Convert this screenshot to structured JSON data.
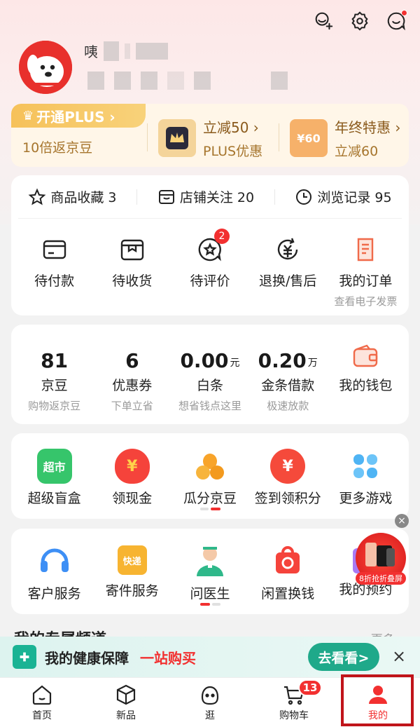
{
  "header": {
    "user_name_prefix": "咦",
    "icons": [
      "add-friend-icon",
      "settings-icon",
      "message-icon"
    ]
  },
  "plus": {
    "badge_label": "开通PLUS ›",
    "badge_sub": "10倍返京豆",
    "item1_title": "立减50 ›",
    "item1_sub": "PLUS优惠",
    "item2_title": "年终特惠 ›",
    "item2_sub": "立减60",
    "item2_icon_text": "¥60"
  },
  "favorites": {
    "items": [
      {
        "label": "商品收藏 3"
      },
      {
        "label": "店铺关注 20"
      },
      {
        "label": "浏览记录 95"
      }
    ]
  },
  "orders": {
    "items": [
      {
        "label": "待付款"
      },
      {
        "label": "待收货"
      },
      {
        "label": "待评价",
        "badge": "2"
      },
      {
        "label": "退换/售后"
      },
      {
        "label": "我的订单",
        "sub": "查看电子发票"
      }
    ]
  },
  "assets": {
    "items": [
      {
        "value": "81",
        "unit": "",
        "label": "京豆",
        "sub": "购物返京豆"
      },
      {
        "value": "6",
        "unit": "",
        "label": "优惠券",
        "sub": "下单立省"
      },
      {
        "value": "0.00",
        "unit": "元",
        "label": "白条",
        "sub": "想省钱点这里"
      },
      {
        "value": "0.20",
        "unit": "万",
        "label": "金条借款",
        "sub": "极速放款"
      },
      {
        "value": "",
        "unit": "",
        "label": "我的钱包",
        "sub": ""
      }
    ]
  },
  "games": {
    "items": [
      {
        "label": "超级盲盒",
        "icon_text": "超市"
      },
      {
        "label": "领现金",
        "icon_text": "¥"
      },
      {
        "label": "瓜分京豆"
      },
      {
        "label": "签到领积分",
        "icon_text": "¥"
      },
      {
        "label": "更多游戏"
      }
    ]
  },
  "services": {
    "items": [
      {
        "label": "客户服务"
      },
      {
        "label": "寄件服务",
        "icon_text": "快递"
      },
      {
        "label": "问医生"
      },
      {
        "label": "闲置换钱"
      },
      {
        "label": "我的预约"
      }
    ]
  },
  "float_ad": {
    "label": "8折抢折叠屏"
  },
  "section_peek": {
    "title": "我的专属频道",
    "more": "更多 ›"
  },
  "health_banner": {
    "title": "我的健康保障",
    "highlight": "一站购买",
    "button": "去看看>",
    "close": "×"
  },
  "tabbar": {
    "items": [
      {
        "label": "首页"
      },
      {
        "label": "新品"
      },
      {
        "label": "逛"
      },
      {
        "label": "购物车",
        "badge": "13"
      },
      {
        "label": "我的"
      }
    ],
    "active": "我的"
  },
  "colors": {
    "brand_red": "#f23030",
    "plus_gold": "#f6c15a",
    "health_green": "#1fa98a"
  }
}
